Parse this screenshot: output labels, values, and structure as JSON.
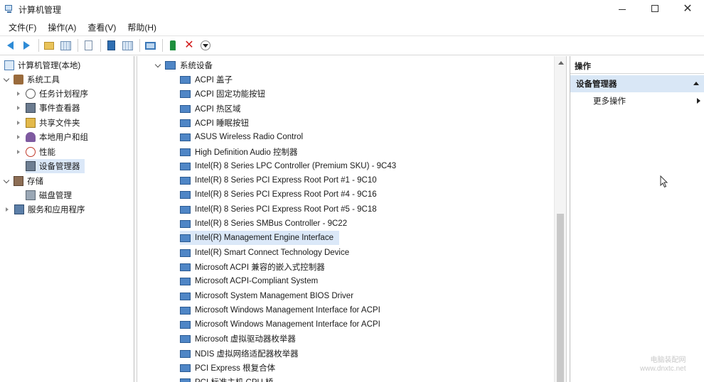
{
  "window": {
    "title": "计算机管理"
  },
  "window_controls": {
    "minimize": "—",
    "maximize": "☐",
    "close": "✕"
  },
  "menu": [
    "文件(F)",
    "操作(A)",
    "查看(V)",
    "帮助(H)"
  ],
  "toolbar": {
    "items": [
      "back-icon",
      "forward-icon",
      "up-folder-icon",
      "show-hide-tree-icon",
      "properties-icon",
      "help-icon",
      "details-view-icon",
      "scan-hardware-icon",
      "enable-device-icon",
      "uninstall-device-icon",
      "update-driver-icon"
    ]
  },
  "left_tree": {
    "items": [
      {
        "label": "计算机管理(本地)",
        "level": 0,
        "expander": "none",
        "icon": "computer-management-icon"
      },
      {
        "label": "系统工具",
        "level": 1,
        "expander": "expanded",
        "icon": "system-tools-icon"
      },
      {
        "label": "任务计划程序",
        "level": 2,
        "expander": "collapsed",
        "icon": "task-scheduler-icon"
      },
      {
        "label": "事件查看器",
        "level": 2,
        "expander": "collapsed",
        "icon": "event-viewer-icon"
      },
      {
        "label": "共享文件夹",
        "level": 2,
        "expander": "collapsed",
        "icon": "shared-folders-icon"
      },
      {
        "label": "本地用户和组",
        "level": 2,
        "expander": "collapsed",
        "icon": "local-users-icon"
      },
      {
        "label": "性能",
        "level": 2,
        "expander": "collapsed",
        "icon": "performance-icon"
      },
      {
        "label": "设备管理器",
        "level": 2,
        "expander": "none",
        "icon": "device-manager-icon",
        "selected": true
      },
      {
        "label": "存储",
        "level": 1,
        "expander": "expanded",
        "icon": "storage-icon"
      },
      {
        "label": "磁盘管理",
        "level": 2,
        "expander": "none",
        "icon": "disk-management-icon"
      },
      {
        "label": "服务和应用程序",
        "level": 1,
        "expander": "collapsed",
        "icon": "services-apps-icon"
      }
    ]
  },
  "device_tree": {
    "category": "系统设备",
    "devices": [
      "ACPI 盖子",
      "ACPI 固定功能按钮",
      "ACPI 热区域",
      "ACPI 睡眠按钮",
      "ASUS Wireless Radio Control",
      "High Definition Audio 控制器",
      "Intel(R) 8 Series LPC Controller (Premium SKU) - 9C43",
      "Intel(R) 8 Series PCI Express Root Port #1 - 9C10",
      "Intel(R) 8 Series PCI Express Root Port #4 - 9C16",
      "Intel(R) 8 Series PCI Express Root Port #5 - 9C18",
      "Intel(R) 8 Series SMBus Controller - 9C22",
      "Intel(R) Management Engine Interface",
      "Intel(R) Smart Connect Technology Device",
      "Microsoft ACPI 兼容的嵌入式控制器",
      "Microsoft ACPI-Compliant System",
      "Microsoft System Management BIOS Driver",
      "Microsoft Windows Management Interface for ACPI",
      "Microsoft Windows Management Interface for ACPI",
      "Microsoft 虚拟驱动器枚举器",
      "NDIS 虚拟网络适配器枚举器",
      "PCI Express 根复合体",
      "PCI 标准主机 CPU 桥"
    ],
    "selected_index": 11
  },
  "actions": {
    "header": "操作",
    "section": "设备管理器",
    "more": "更多操作"
  },
  "watermark": {
    "line1": "电脑装配网",
    "line2": "www.dnxtc.net"
  },
  "colors": {
    "selection": "#dbe8f8",
    "section_bg": "#d9e7f6",
    "device_icon": "#4f86c6"
  }
}
